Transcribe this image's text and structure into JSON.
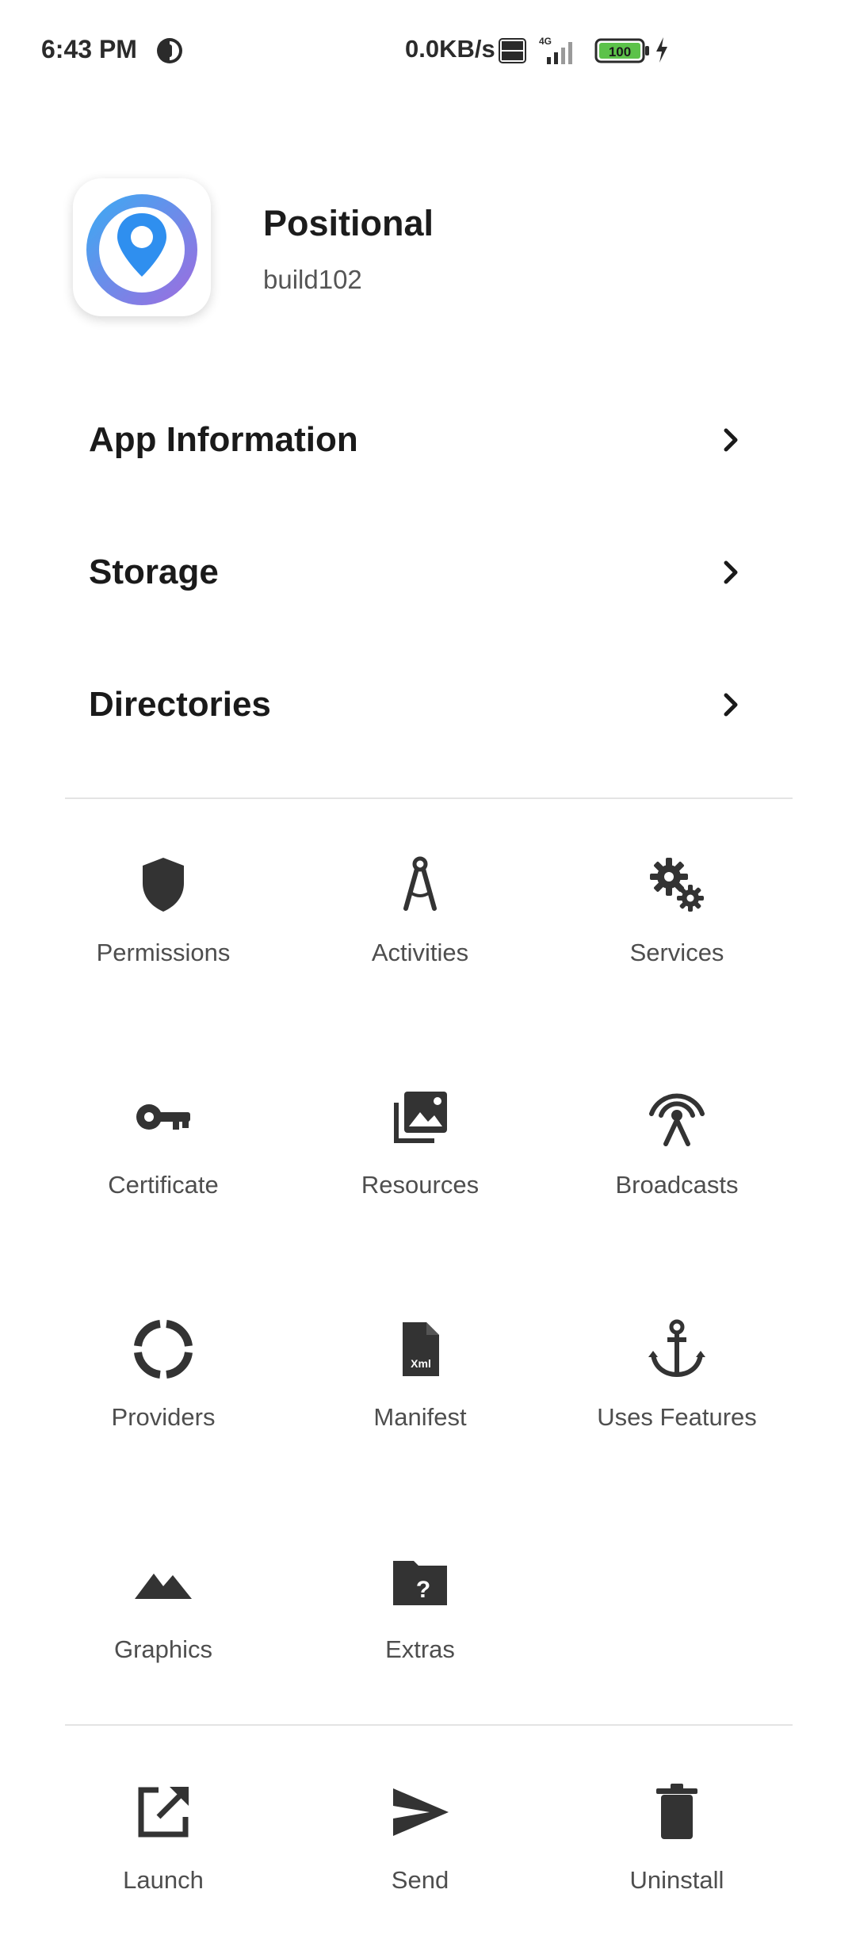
{
  "status_bar": {
    "time": "6:43 PM",
    "network_speed": "0.0KB/s",
    "network_type": "4G",
    "volte": "Vo LTE",
    "battery": "100"
  },
  "app": {
    "name": "Positional",
    "build": "build102",
    "accent_colors": [
      "#3aa0f0",
      "#8a6de0"
    ]
  },
  "sections": [
    {
      "label": "App Information",
      "icon": "chevron-right-icon"
    },
    {
      "label": "Storage",
      "icon": "chevron-right-icon"
    },
    {
      "label": "Directories",
      "icon": "chevron-right-icon"
    }
  ],
  "grid": [
    {
      "label": "Permissions",
      "icon": "shield-icon"
    },
    {
      "label": "Activities",
      "icon": "compass-drafting-icon"
    },
    {
      "label": "Services",
      "icon": "gears-icon"
    },
    {
      "label": "Certificate",
      "icon": "key-icon"
    },
    {
      "label": "Resources",
      "icon": "photo-library-icon"
    },
    {
      "label": "Broadcasts",
      "icon": "broadcast-tower-icon"
    },
    {
      "label": "Providers",
      "icon": "circle-segments-icon"
    },
    {
      "label": "Manifest",
      "icon": "xml-file-icon"
    },
    {
      "label": "Uses Features",
      "icon": "anchor-icon"
    },
    {
      "label": "Graphics",
      "icon": "mountains-icon"
    },
    {
      "label": "Extras",
      "icon": "folder-question-icon"
    }
  ],
  "actions": [
    {
      "label": "Launch",
      "icon": "open-external-icon"
    },
    {
      "label": "Send",
      "icon": "send-icon"
    },
    {
      "label": "Uninstall",
      "icon": "trash-icon"
    }
  ]
}
